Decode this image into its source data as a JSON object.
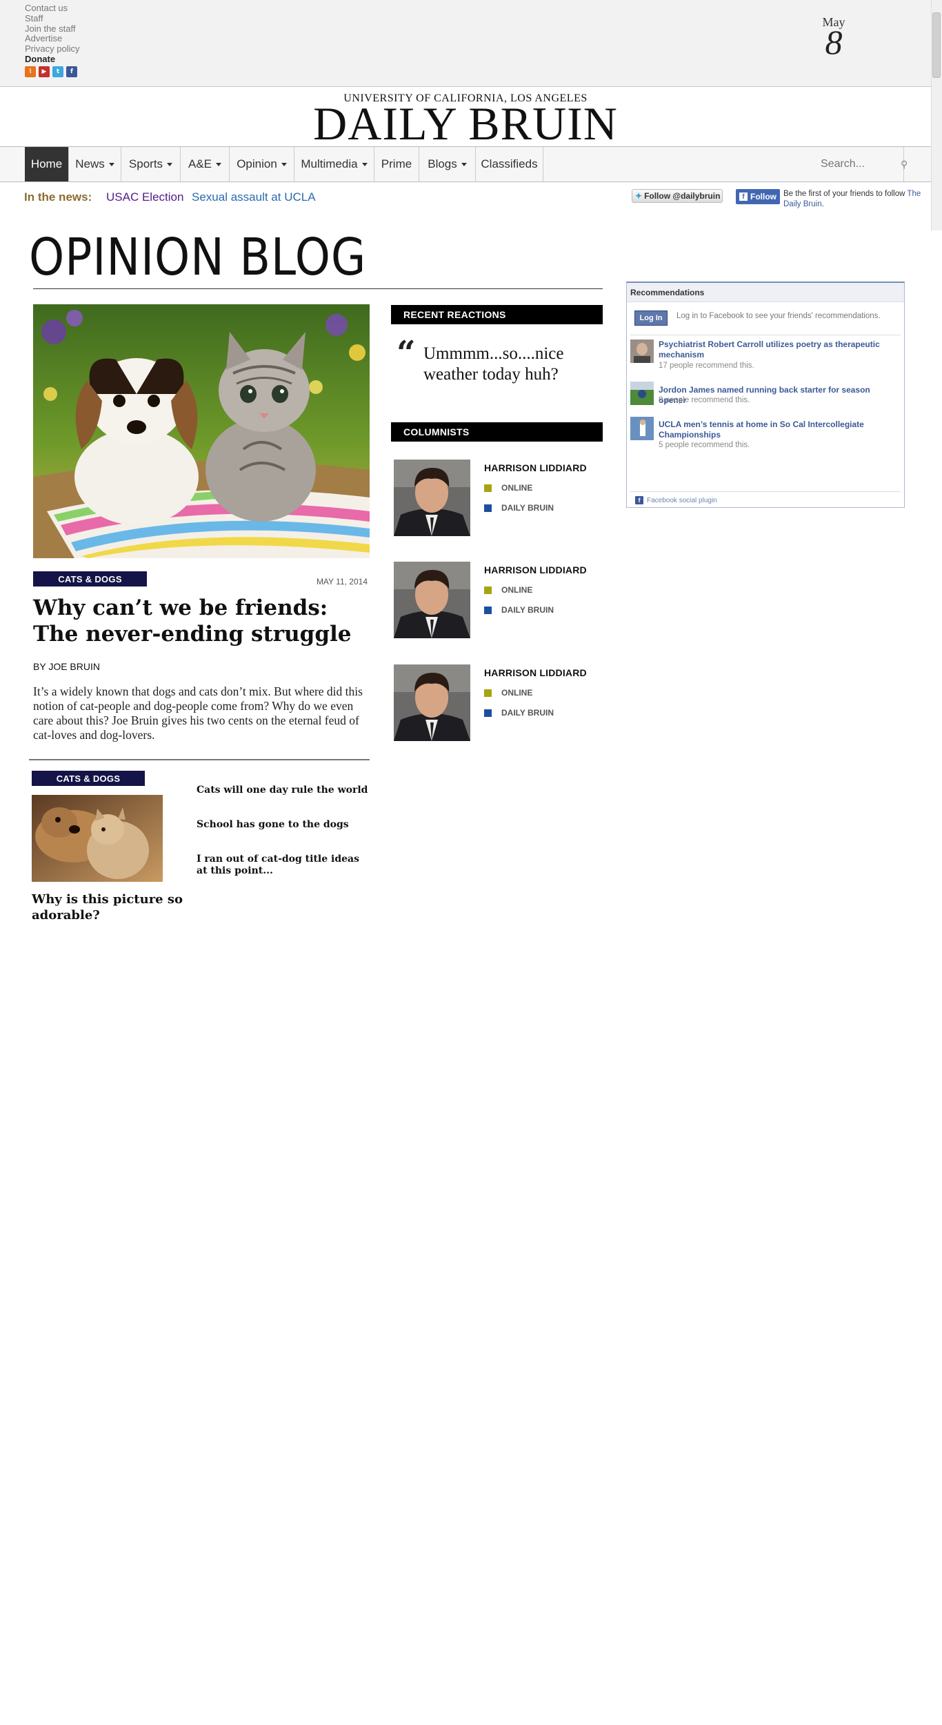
{
  "util_links": [
    "Contact us",
    "Staff",
    "Join the staff",
    "Advertise",
    "Privacy policy"
  ],
  "donate": "Donate",
  "date": {
    "month": "May",
    "day": "8"
  },
  "masthead": {
    "small": "UNIVERSITY OF CALIFORNIA, LOS ANGELES",
    "big": "DAILY BRUIN"
  },
  "nav": {
    "items": [
      {
        "label": "Home",
        "dropdown": false
      },
      {
        "label": "News",
        "dropdown": true
      },
      {
        "label": "Sports",
        "dropdown": true
      },
      {
        "label": "A&E",
        "dropdown": true
      },
      {
        "label": "Opinion",
        "dropdown": true
      },
      {
        "label": "Multimedia",
        "dropdown": true
      },
      {
        "label": "Prime",
        "dropdown": false
      },
      {
        "label": "Blogs",
        "dropdown": true
      },
      {
        "label": "Classifieds",
        "dropdown": false
      }
    ],
    "search_placeholder": "Search..."
  },
  "in_the_news": {
    "label": "In the news:",
    "links": [
      "USAC Election",
      "Sexual assault at UCLA"
    ],
    "twitter_follow": "Follow @dailybruin",
    "fb_follow": "Follow",
    "fb_follow_text": "Be the first of your friends to follow",
    "fb_follow_link": "The Daily Bruin"
  },
  "blog_title": "OPINION BLOG",
  "main_post": {
    "category": "CATS & DOGS",
    "date": "MAY 11, 2014",
    "title": "Why can’t we be friends: The never-ending struggle",
    "byline": "BY JOE BRUIN",
    "excerpt": "It’s a widely known that dogs and cats don’t mix. But where did this notion of cat-people and dog-people come from? Why do we even care about this? Joe Bruin gives his two cents on the eternal feud of cat-loves and dog-lovers."
  },
  "secondary": {
    "category": "CATS & DOGS",
    "title": "Why is this picture so adorable?",
    "headlines": [
      "Cats will one day rule the world",
      "School has gone to the dogs",
      "I ran out of cat-dog title ideas at this point..."
    ]
  },
  "recent_reactions": {
    "header": "RECENT REACTIONS",
    "quote_mark": "“",
    "quote": "Ummmm...so....nice weather today huh?"
  },
  "columnists": {
    "header": "COLUMNISTS",
    "items": [
      {
        "name": "HARRISON LIDDIARD",
        "tags": [
          "ONLINE",
          "DAILY BRUIN"
        ]
      },
      {
        "name": "HARRISON LIDDIARD",
        "tags": [
          "ONLINE",
          "DAILY BRUIN"
        ]
      },
      {
        "name": "HARRISON LIDDIARD",
        "tags": [
          "ONLINE",
          "DAILY BRUIN"
        ]
      }
    ],
    "tag_colors": [
      "#a5a512",
      "#1d4f9e"
    ]
  },
  "fb_recommendations": {
    "header": "Recommendations",
    "login_button": "Log In",
    "login_text": "Log in to Facebook to see your friends' recommendations.",
    "items": [
      {
        "title": "Psychiatrist Robert Carroll utilizes poetry as therapeutic mechanism",
        "count": "17 people recommend this."
      },
      {
        "title": "Jordon James named running back starter for season opener",
        "count": "9 people recommend this."
      },
      {
        "title": "UCLA men’s tennis at home in So Cal Intercollegiate Championships",
        "count": "5 people recommend this."
      }
    ],
    "footer": "Facebook social plugin"
  },
  "colors": {
    "tag_navy": "#141448",
    "news_label": "#8c6b2e",
    "link_visited": "#551a8b",
    "link": "#2a6ab0",
    "fb_blue": "#3b5998"
  },
  "icons": [
    "rss-icon",
    "youtube-icon",
    "twitter-icon",
    "facebook-icon",
    "search-icon"
  ]
}
